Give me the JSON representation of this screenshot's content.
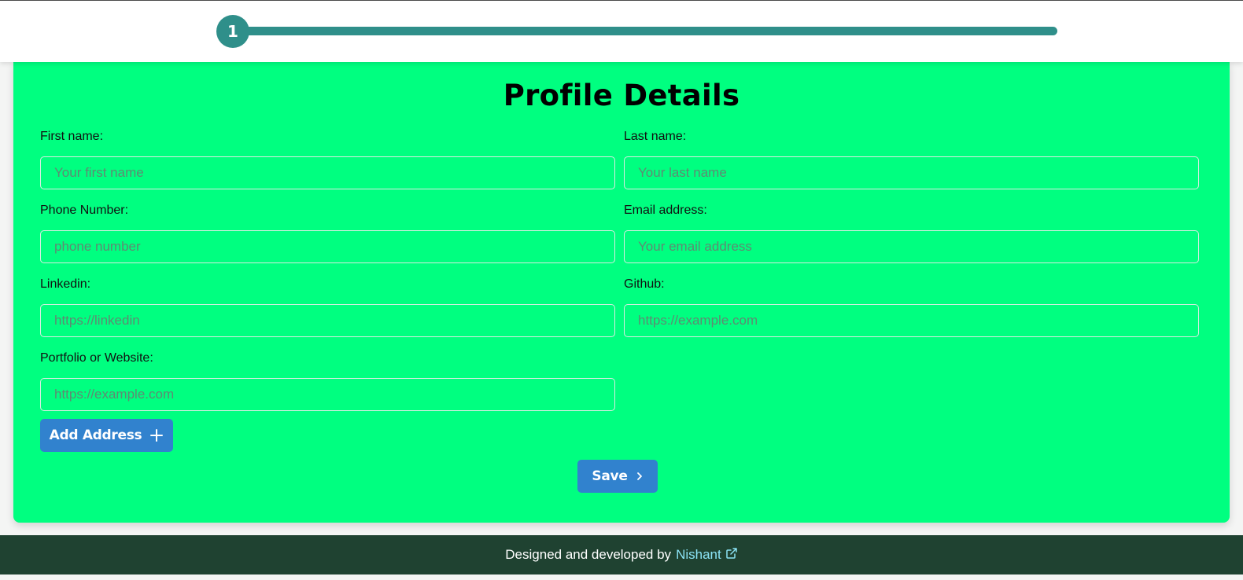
{
  "progress": {
    "current_step": "1"
  },
  "form": {
    "title": "Profile Details",
    "fields": [
      {
        "label": "First name:",
        "placeholder": "Your first name",
        "value": ""
      },
      {
        "label": "Last name:",
        "placeholder": "Your last name",
        "value": ""
      },
      {
        "label": "Phone Number:",
        "placeholder": "phone number",
        "value": ""
      },
      {
        "label": "Email address:",
        "placeholder": "Your email address",
        "value": ""
      },
      {
        "label": "Linkedin:",
        "placeholder": "https://linkedin",
        "value": ""
      },
      {
        "label": "Github:",
        "placeholder": "https://example.com",
        "value": ""
      },
      {
        "label": "Portfolio or Website:",
        "placeholder": "https://example.com",
        "value": ""
      }
    ],
    "add_address_label": "Add Address",
    "save_label": "Save"
  },
  "footer": {
    "text": "Designed and developed by",
    "author": "Nishant"
  },
  "icons": {
    "add": "plus-icon",
    "save": "chevron-right-icon",
    "link": "external-link-icon"
  },
  "colors": {
    "card_bg": "#00ff80",
    "accent": "#3182ce",
    "progress": "#2f8f8a",
    "footer_bg": "#1f4231",
    "link": "#8be3f5"
  }
}
